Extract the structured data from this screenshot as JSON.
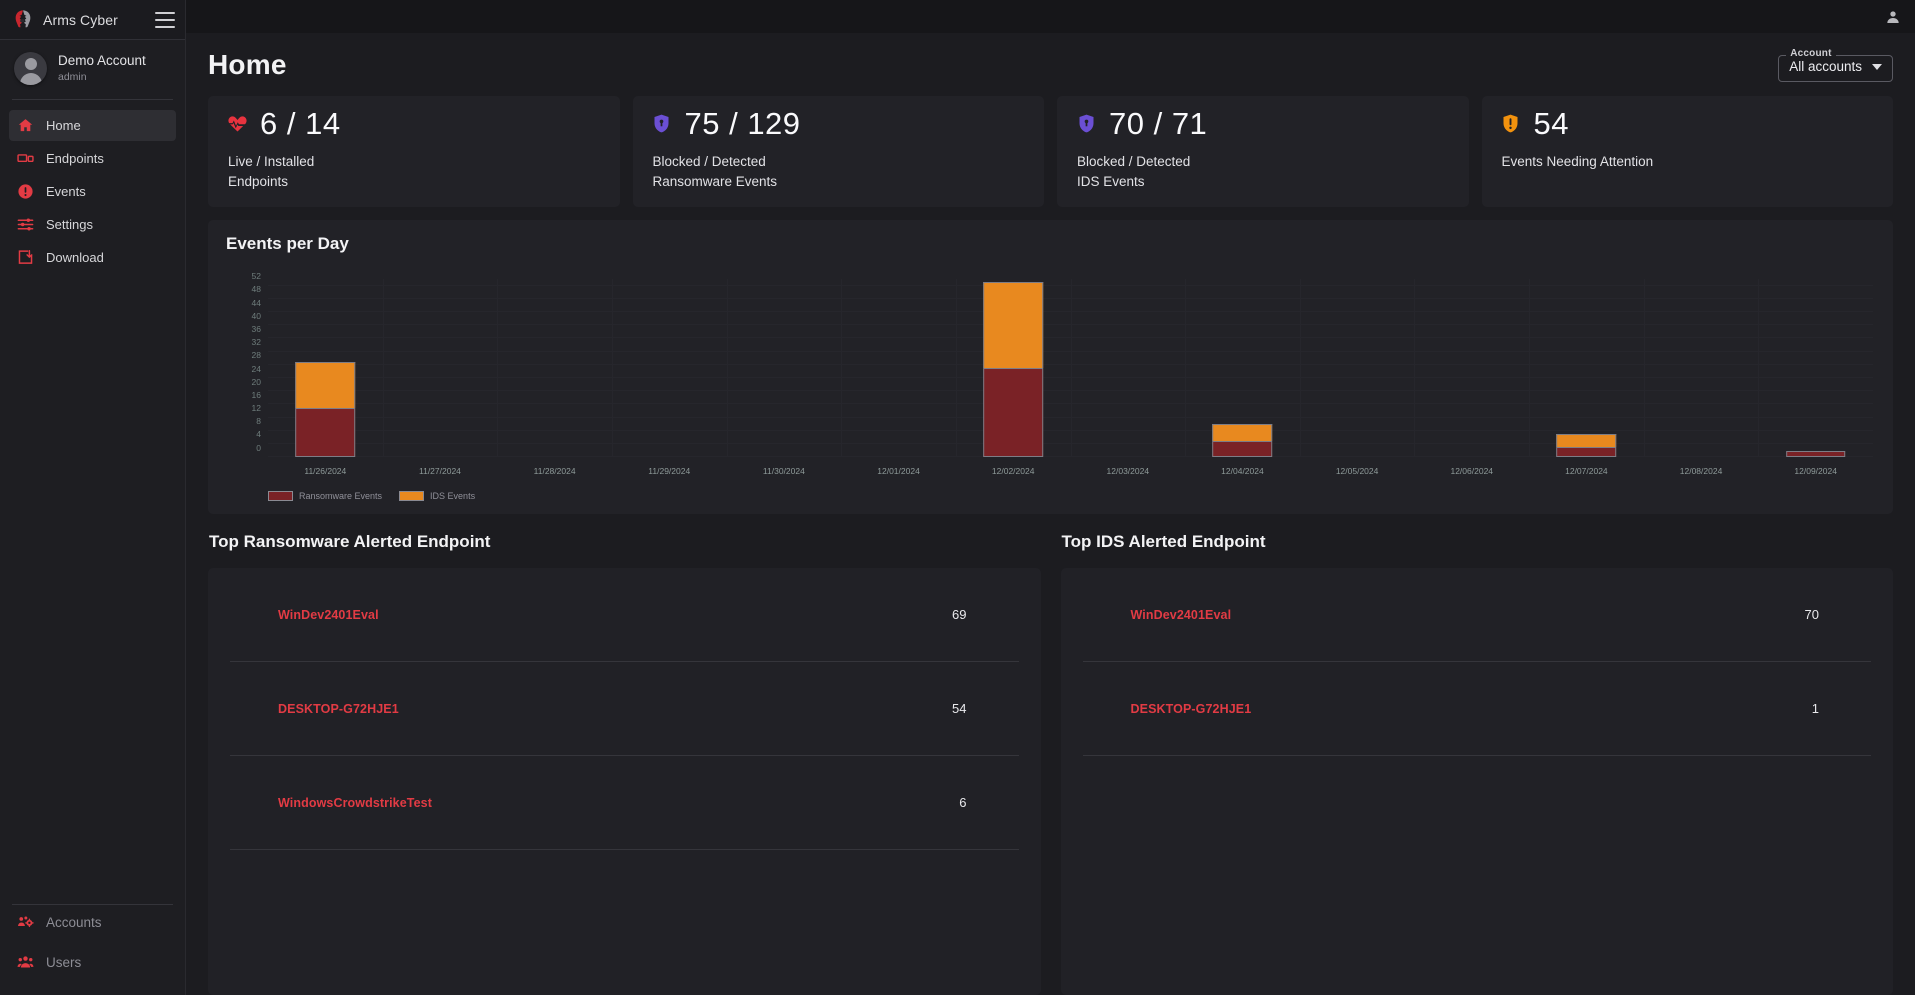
{
  "brand": {
    "name": "Arms Cyber",
    "logo_icon": "spartan-helmet-icon",
    "menu_icon": "hamburger-icon"
  },
  "user": {
    "name": "Demo Account",
    "role": "admin",
    "avatar_icon": "user-avatar-icon"
  },
  "sidebar": {
    "items": [
      {
        "label": "Home",
        "icon": "home-icon",
        "active": true
      },
      {
        "label": "Endpoints",
        "icon": "endpoints-icon",
        "active": false
      },
      {
        "label": "Events",
        "icon": "alert-circle-icon",
        "active": false
      },
      {
        "label": "Settings",
        "icon": "sliders-icon",
        "active": false
      },
      {
        "label": "Download",
        "icon": "download-icon",
        "active": false
      }
    ],
    "bottom_items": [
      {
        "label": "Accounts",
        "icon": "accounts-gear-icon"
      },
      {
        "label": "Users",
        "icon": "users-icon"
      }
    ]
  },
  "topbar": {
    "profile_icon": "person-icon"
  },
  "header": {
    "title": "Home",
    "account_select": {
      "legend": "Account",
      "value": "All accounts",
      "caret_icon": "chevron-down-icon"
    }
  },
  "cards": [
    {
      "icon": "heartbeat-icon",
      "icon_color": "#e8333f",
      "value": "6 / 14",
      "label_line1": "Live / Installed",
      "label_line2": "Endpoints"
    },
    {
      "icon": "shield-lock-icon",
      "icon_color": "#6b4fd4",
      "value": "75 / 129",
      "label_line1": "Blocked / Detected",
      "label_line2": "Ransomware Events"
    },
    {
      "icon": "shield-lock-icon",
      "icon_color": "#6b4fd4",
      "value": "70 / 71",
      "label_line1": "Blocked / Detected",
      "label_line2": "IDS Events"
    },
    {
      "icon": "shield-alert-icon",
      "icon_color": "#f2920e",
      "value": "54",
      "label_line1": "Events Needing Attention",
      "label_line2": ""
    }
  ],
  "chart_panel": {
    "title": "Events per Day"
  },
  "chart_data": {
    "type": "bar",
    "stacked": true,
    "title": "Events per Day",
    "xlabel": "",
    "ylabel": "",
    "ylim": [
      0,
      54
    ],
    "yticks": [
      0,
      4,
      8,
      12,
      16,
      20,
      24,
      28,
      32,
      36,
      40,
      44,
      48,
      52
    ],
    "grid": true,
    "legend_position": "bottom-left",
    "categories": [
      "11/26/2024",
      "11/27/2024",
      "11/28/2024",
      "11/29/2024",
      "11/30/2024",
      "12/01/2024",
      "12/02/2024",
      "12/03/2024",
      "12/04/2024",
      "12/05/2024",
      "12/06/2024",
      "12/07/2024",
      "12/08/2024",
      "12/09/2024"
    ],
    "series": [
      {
        "name": "Ransomware Events",
        "color": "#7a2226",
        "values": [
          15,
          0,
          0,
          0,
          0,
          0,
          27,
          0,
          5,
          0,
          0,
          3,
          0,
          2
        ]
      },
      {
        "name": "IDS Events",
        "color": "#e8891f",
        "values": [
          14,
          0,
          0,
          0,
          0,
          0,
          26,
          0,
          5,
          0,
          0,
          4,
          0,
          0
        ]
      }
    ]
  },
  "ransomware_table": {
    "title": "Top Ransomware Alerted Endpoint",
    "rows": [
      {
        "name": "WinDev2401Eval",
        "count": "69"
      },
      {
        "name": "DESKTOP-G72HJE1",
        "count": "54"
      },
      {
        "name": "WindowsCrowdstrikeTest",
        "count": "6"
      }
    ]
  },
  "ids_table": {
    "title": "Top IDS Alerted Endpoint",
    "rows": [
      {
        "name": "WinDev2401Eval",
        "count": "70"
      },
      {
        "name": "DESKTOP-G72HJE1",
        "count": "1"
      }
    ]
  },
  "colors": {
    "accent_red": "#e23b44",
    "ransomware": "#7a2226",
    "ids": "#e8891f",
    "purple": "#6b4fd4",
    "orange": "#f2920e",
    "bg": "#1c1c20",
    "panel": "#222227"
  }
}
